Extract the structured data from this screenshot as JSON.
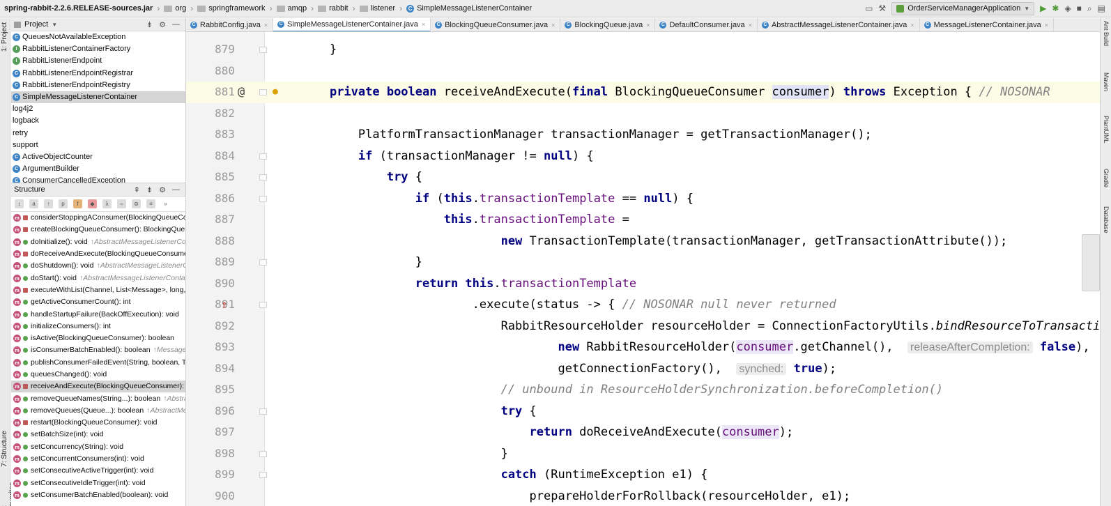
{
  "navbar": {
    "crumbs": [
      "spring-rabbit-2.2.6.RELEASE-sources.jar",
      "org",
      "springframework",
      "amqp",
      "rabbit",
      "listener",
      "SimpleMessageListenerContainer"
    ],
    "run_config": "OrderServiceManagerApplication"
  },
  "left_stripe": {
    "project": "1: Project",
    "structure": "7: Structure",
    "favorites": "2: Favorites"
  },
  "right_stripe": {
    "ant": "Ant Build",
    "maven": "Maven",
    "plantuml": "PlantUML",
    "gradle": "Gradle",
    "database": "Database"
  },
  "project_panel": {
    "title": "Project",
    "items": [
      {
        "label": "QueuesNotAvailableException",
        "icon": "class"
      },
      {
        "label": "RabbitListenerContainerFactory",
        "icon": "interface"
      },
      {
        "label": "RabbitListenerEndpoint",
        "icon": "interface"
      },
      {
        "label": "RabbitListenerEndpointRegistrar",
        "icon": "class"
      },
      {
        "label": "RabbitListenerEndpointRegistry",
        "icon": "class"
      },
      {
        "label": "SimpleMessageListenerContainer",
        "icon": "class"
      },
      {
        "label": "log4j2",
        "icon": "none"
      },
      {
        "label": "logback",
        "icon": "none"
      },
      {
        "label": "retry",
        "icon": "none"
      },
      {
        "label": "support",
        "icon": "none"
      },
      {
        "label": "ActiveObjectCounter",
        "icon": "class"
      },
      {
        "label": "ArgumentBuilder",
        "icon": "class"
      },
      {
        "label": "ConsumerCancelledException",
        "icon": "class"
      }
    ]
  },
  "structure_panel": {
    "title": "Structure",
    "items": [
      {
        "name": "considerStoppingAConsumer(BlockingQueueConsumer): boolean",
        "vis": "private",
        "extra": ""
      },
      {
        "name": "createBlockingQueueConsumer(): BlockingQueueConsumer",
        "vis": "private",
        "extra": ""
      },
      {
        "name": "doInitialize(): void",
        "vis": "public",
        "extra": "↑AbstractMessageListenerContainer"
      },
      {
        "name": "doReceiveAndExecute(BlockingQueueConsumer): boolean",
        "vis": "private",
        "extra": ""
      },
      {
        "name": "doShutdown(): void",
        "vis": "public",
        "extra": "↑AbstractMessageListenerContainer"
      },
      {
        "name": "doStart(): void",
        "vis": "public",
        "extra": "↑AbstractMessageListenerContainer"
      },
      {
        "name": "executeWithList(Channel, List<Message>, long, BlockingQueueConsumer): void",
        "vis": "private",
        "extra": ""
      },
      {
        "name": "getActiveConsumerCount(): int",
        "vis": "public",
        "extra": ""
      },
      {
        "name": "handleStartupFailure(BackOffExecution): void",
        "vis": "public",
        "extra": ""
      },
      {
        "name": "initializeConsumers(): int",
        "vis": "public",
        "extra": ""
      },
      {
        "name": "isActive(BlockingQueueConsumer): boolean",
        "vis": "public",
        "extra": ""
      },
      {
        "name": "isConsumerBatchEnabled(): boolean",
        "vis": "public",
        "extra": "↑MessageListenerContainer"
      },
      {
        "name": "publishConsumerFailedEvent(String, boolean, Throwable): void",
        "vis": "public",
        "extra": ""
      },
      {
        "name": "queuesChanged(): void",
        "vis": "public",
        "extra": ""
      },
      {
        "name": "receiveAndExecute(BlockingQueueConsumer): boolean",
        "vis": "private",
        "extra": ""
      },
      {
        "name": "removeQueueNames(String...): boolean",
        "vis": "public",
        "extra": "↑AbstractMessageListenerContainer"
      },
      {
        "name": "removeQueues(Queue...): boolean",
        "vis": "public",
        "extra": "↑AbstractMessageListenerContainer"
      },
      {
        "name": "restart(BlockingQueueConsumer): void",
        "vis": "private",
        "extra": ""
      },
      {
        "name": "setBatchSize(int): void",
        "vis": "public",
        "extra": ""
      },
      {
        "name": "setConcurrency(String): void",
        "vis": "public",
        "extra": ""
      },
      {
        "name": "setConcurrentConsumers(int): void",
        "vis": "public",
        "extra": ""
      },
      {
        "name": "setConsecutiveActiveTrigger(int): void",
        "vis": "public",
        "extra": ""
      },
      {
        "name": "setConsecutiveIdleTrigger(int): void",
        "vis": "public",
        "extra": ""
      },
      {
        "name": "setConsumerBatchEnabled(boolean): void",
        "vis": "public",
        "extra": ""
      }
    ]
  },
  "tabs": [
    {
      "label": "RabbitConfig.java",
      "active": false
    },
    {
      "label": "SimpleMessageListenerContainer.java",
      "active": true
    },
    {
      "label": "BlockingQueueConsumer.java",
      "active": false
    },
    {
      "label": "BlockingQueue.java",
      "active": false
    },
    {
      "label": "DefaultConsumer.java",
      "active": false
    },
    {
      "label": "AbstractMessageListenerContainer.java",
      "active": false
    },
    {
      "label": "MessageListenerContainer.java",
      "active": false
    }
  ],
  "editor": {
    "lines": [
      {
        "n": "879",
        "current": false,
        "marker": "",
        "fold": true,
        "html": "    }"
      },
      {
        "n": "880",
        "current": false,
        "marker": "",
        "fold": false,
        "html": ""
      },
      {
        "n": "881",
        "current": true,
        "marker": "@",
        "fold": true,
        "bulb": true,
        "html": "    <span class=\"kw\">private boolean</span> receiveAndExecute(<span class=\"kw\">final</span> BlockingQueueConsumer <span class=\"hlv\">consumer</span>) <span class=\"kw\">throws</span> Exception { <span class=\"cmt\">// NOSONAR</span>"
      },
      {
        "n": "882",
        "current": false,
        "marker": "",
        "fold": false,
        "html": ""
      },
      {
        "n": "883",
        "current": false,
        "marker": "",
        "fold": false,
        "html": "        PlatformTransactionManager transactionManager = getTransactionManager();"
      },
      {
        "n": "884",
        "current": false,
        "marker": "",
        "fold": true,
        "html": "        <span class=\"kw\">if</span> (transactionManager != <span class=\"kw\">null</span>) {"
      },
      {
        "n": "885",
        "current": false,
        "marker": "",
        "fold": true,
        "html": "            <span class=\"kw\">try</span> {"
      },
      {
        "n": "886",
        "current": false,
        "marker": "",
        "fold": true,
        "html": "                <span class=\"kw\">if</span> (<span class=\"kw\">this</span>.<span class=\"fld\">transactionTemplate</span> == <span class=\"kw\">null</span>) {"
      },
      {
        "n": "887",
        "current": false,
        "marker": "",
        "fold": false,
        "html": "                    <span class=\"kw\">this</span>.<span class=\"fld\">transactionTemplate</span> ="
      },
      {
        "n": "888",
        "current": false,
        "marker": "",
        "fold": false,
        "html": "                            <span class=\"kw\">new</span> TransactionTemplate(transactionManager, getTransactionAttribute());"
      },
      {
        "n": "889",
        "current": false,
        "marker": "",
        "fold": true,
        "html": "                }"
      },
      {
        "n": "890",
        "current": false,
        "marker": "",
        "fold": false,
        "html": "                <span class=\"kw\">return this</span>.<span class=\"fld\">transactionTemplate</span>"
      },
      {
        "n": "891",
        "current": false,
        "marker": "impl",
        "fold": true,
        "html": "                        .execute(status -> { <span class=\"cmt\">// NOSONAR null never returned</span>"
      },
      {
        "n": "892",
        "current": false,
        "marker": "",
        "fold": false,
        "html": "                            RabbitResourceHolder resourceHolder = ConnectionFactoryUtils.<span class=\"itl\">bindResourceToTransaction</span>("
      },
      {
        "n": "893",
        "current": false,
        "marker": "",
        "fold": false,
        "html": "                                    <span class=\"kw\">new</span> RabbitResourceHolder(<span class=\"hl\">consumer</span>.getChannel(),  <span class=\"hint\">releaseAfterCompletion:</span> <span class=\"hint-val\">false</span>),"
      },
      {
        "n": "894",
        "current": false,
        "marker": "",
        "fold": false,
        "html": "                                    getConnectionFactory(),  <span class=\"hint\">synched:</span> <span class=\"kw\">true</span>);"
      },
      {
        "n": "895",
        "current": false,
        "marker": "",
        "fold": false,
        "html": "                            <span class=\"cmt\">// unbound in ResourceHolderSynchronization.beforeCompletion()</span>"
      },
      {
        "n": "896",
        "current": false,
        "marker": "",
        "fold": true,
        "html": "                            <span class=\"kw\">try</span> {"
      },
      {
        "n": "897",
        "current": false,
        "marker": "",
        "fold": false,
        "html": "                                <span class=\"kw\">return</span> doReceiveAndExecute(<span class=\"hl\">consumer</span>);"
      },
      {
        "n": "898",
        "current": false,
        "marker": "",
        "fold": true,
        "html": "                            }"
      },
      {
        "n": "899",
        "current": false,
        "marker": "",
        "fold": true,
        "html": "                            <span class=\"kw\">catch</span> (RuntimeException e1) {"
      },
      {
        "n": "900",
        "current": false,
        "marker": "",
        "fold": false,
        "html": "                                prepareHolderForRollback(resourceHolder, e1);"
      }
    ]
  }
}
